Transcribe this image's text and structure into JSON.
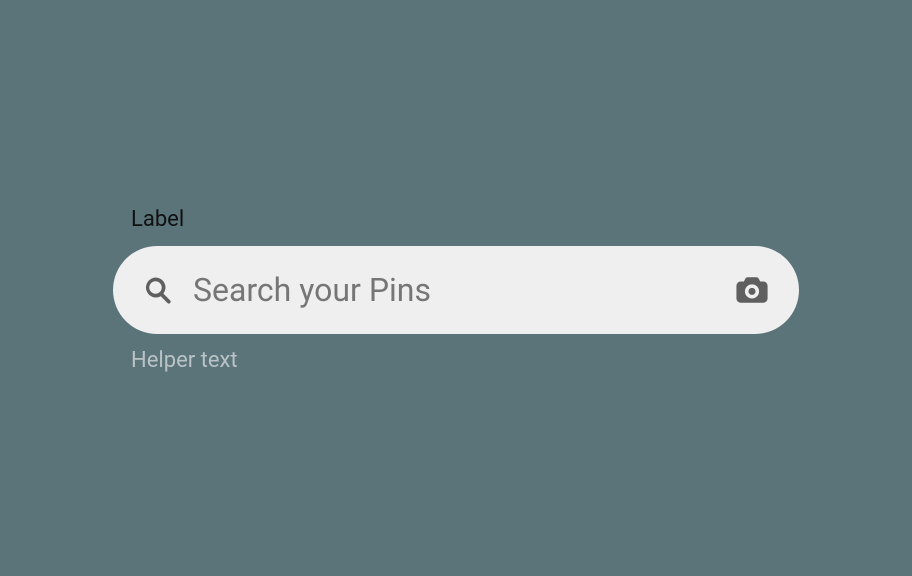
{
  "search": {
    "label": "Label",
    "placeholder": "Search your Pins",
    "helper_text": "Helper text"
  }
}
